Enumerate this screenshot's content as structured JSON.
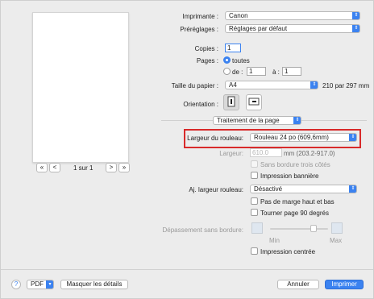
{
  "printer": {
    "label": "Imprimante :",
    "value": "Canon"
  },
  "presets": {
    "label": "Préréglages :",
    "value": "Réglages par défaut"
  },
  "copies": {
    "label": "Copies :",
    "value": "1"
  },
  "pages": {
    "label": "Pages :",
    "all_label": "toutes",
    "from_label": "de :",
    "from_value": "1",
    "to_label": "à :",
    "to_value": "1"
  },
  "paper_size": {
    "label": "Taille du papier :",
    "value": "A4",
    "dimensions": "210 par 297 mm"
  },
  "orientation": {
    "label": "Orientation :"
  },
  "section": {
    "value": "Traitement de la page"
  },
  "roll_width": {
    "label": "Largeur du rouleau:",
    "value": "Rouleau 24 po (609,6mm)"
  },
  "width": {
    "label": "Largeur:",
    "value": "610.0",
    "range": "mm (203.2-917.0)"
  },
  "checks": {
    "borderless_three_sides": "Sans bordure trois côtés",
    "banner_printing": "Impression bannière"
  },
  "adjust_roll_width": {
    "label": "Aj. largeur rouleau:",
    "value": "Désactivé"
  },
  "options": {
    "no_top_bottom_margin": "Pas de marge haut et bas",
    "rotate_90": "Tourner page 90 degrés"
  },
  "overflow": {
    "label": "Dépassement sans bordure:",
    "min_label": "Min",
    "max_label": "Max"
  },
  "centered": {
    "label": "Impression centrée"
  },
  "preview_nav": {
    "page_label": "1 sur 1",
    "first": "«",
    "prev": "<",
    "next": ">",
    "last": "»"
  },
  "footer": {
    "help": "?",
    "pdf": "PDF",
    "hide_details": "Masquer les détails",
    "cancel": "Annuler",
    "print": "Imprimer"
  },
  "colors": {
    "accent": "#3b82f0",
    "highlight": "#d82a2a"
  }
}
